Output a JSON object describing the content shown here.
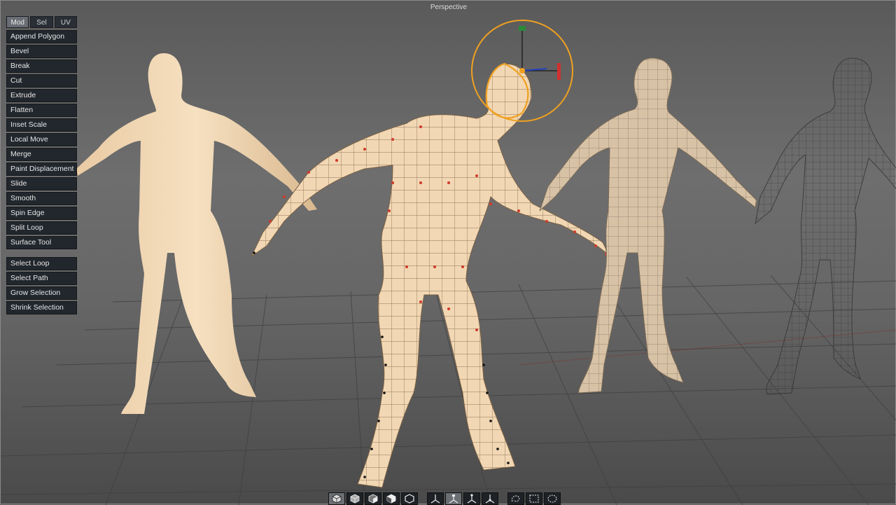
{
  "viewport": {
    "title": "Perspective"
  },
  "tabs": [
    {
      "label": "Mod",
      "active": true
    },
    {
      "label": "Sel",
      "active": false
    },
    {
      "label": "UV",
      "active": false
    }
  ],
  "tools": [
    "Append Polygon",
    "Bevel",
    "Break",
    "Cut",
    "Extrude",
    "Flatten",
    "Inset Scale",
    "Local Move",
    "Merge",
    "Paint Displacement",
    "Slide",
    "Smooth",
    "Spin Edge",
    "Split Loop",
    "Surface Tool"
  ],
  "selection_tools": [
    "Select Loop",
    "Select Path",
    "Grow Selection",
    "Shrink Selection"
  ],
  "bottom_toolbar": {
    "shading_icons": [
      "shaded-cube-icon",
      "wire-cube-icon",
      "half-shaded-cube-icon",
      "flat-cube-icon",
      "outline-cube-icon"
    ],
    "transform_icons": [
      "move-gizmo-icon",
      "rotate-gizmo-icon",
      "scale-gizmo-icon",
      "universal-gizmo-icon"
    ],
    "select_icons": [
      "lasso-select-icon",
      "rect-select-icon",
      "circle-select-icon"
    ]
  },
  "colors": {
    "skin": "#f1d7b3",
    "selection": "#f0a020",
    "vertex": "#d23a2a",
    "gizmo_x": "#d03030",
    "gizmo_y": "#2a8a3a",
    "gizmo_z": "#2040c0"
  }
}
